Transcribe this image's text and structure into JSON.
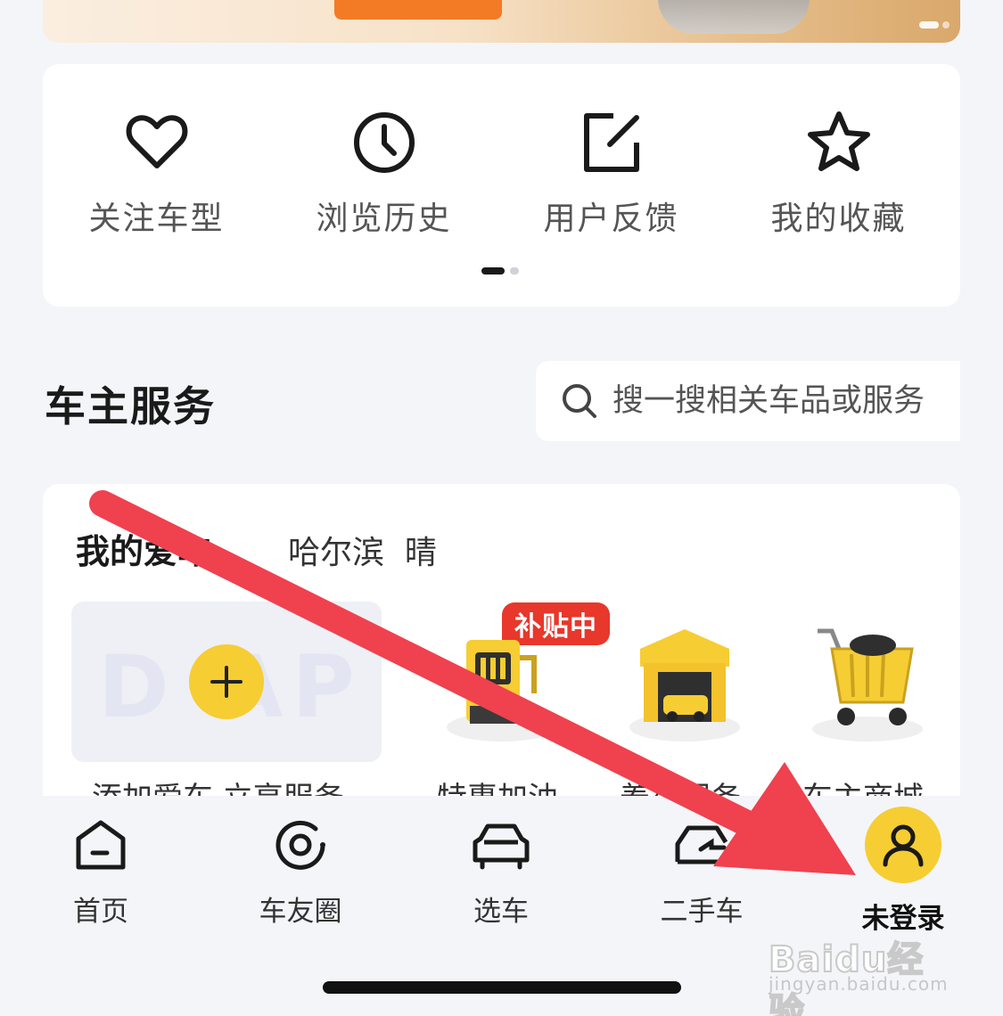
{
  "tools": [
    {
      "label": "关注车型",
      "icon": "heart-icon"
    },
    {
      "label": "浏览历史",
      "icon": "clock-icon"
    },
    {
      "label": "用户反馈",
      "icon": "edit-icon"
    },
    {
      "label": "我的收藏",
      "icon": "star-icon"
    }
  ],
  "tools_pager": {
    "pages": 2,
    "current": 1
  },
  "owner_services": {
    "title": "车主服务",
    "search_placeholder": "搜一搜相关车品或服务"
  },
  "my_car": {
    "title": "我的爱车",
    "city": "哈尔滨",
    "weather": "晴",
    "add_car_label": "添加爱车 立享服务",
    "services": [
      {
        "label": "特惠加油",
        "badge": "补贴中",
        "icon": "fuel-pump-icon"
      },
      {
        "label": "养车服务",
        "icon": "garage-icon"
      },
      {
        "label": "车主商城",
        "icon": "shopping-cart-icon"
      }
    ]
  },
  "tabbar": [
    {
      "label": "首页",
      "icon": "home-icon"
    },
    {
      "label": "车友圈",
      "icon": "circle-icon"
    },
    {
      "label": "选车",
      "icon": "car-icon"
    },
    {
      "label": "二手车",
      "icon": "used-car-icon"
    },
    {
      "label": "未登录",
      "icon": "user-icon",
      "active": true
    }
  ],
  "watermark": {
    "brand": "Baidu经验",
    "sub": "jingyan.baidu.com"
  },
  "colors": {
    "accent_yellow": "#f6cd33",
    "badge_red": "#e8372b",
    "arrow_red": "#f0414e",
    "banner_cta": "#f47b25"
  }
}
